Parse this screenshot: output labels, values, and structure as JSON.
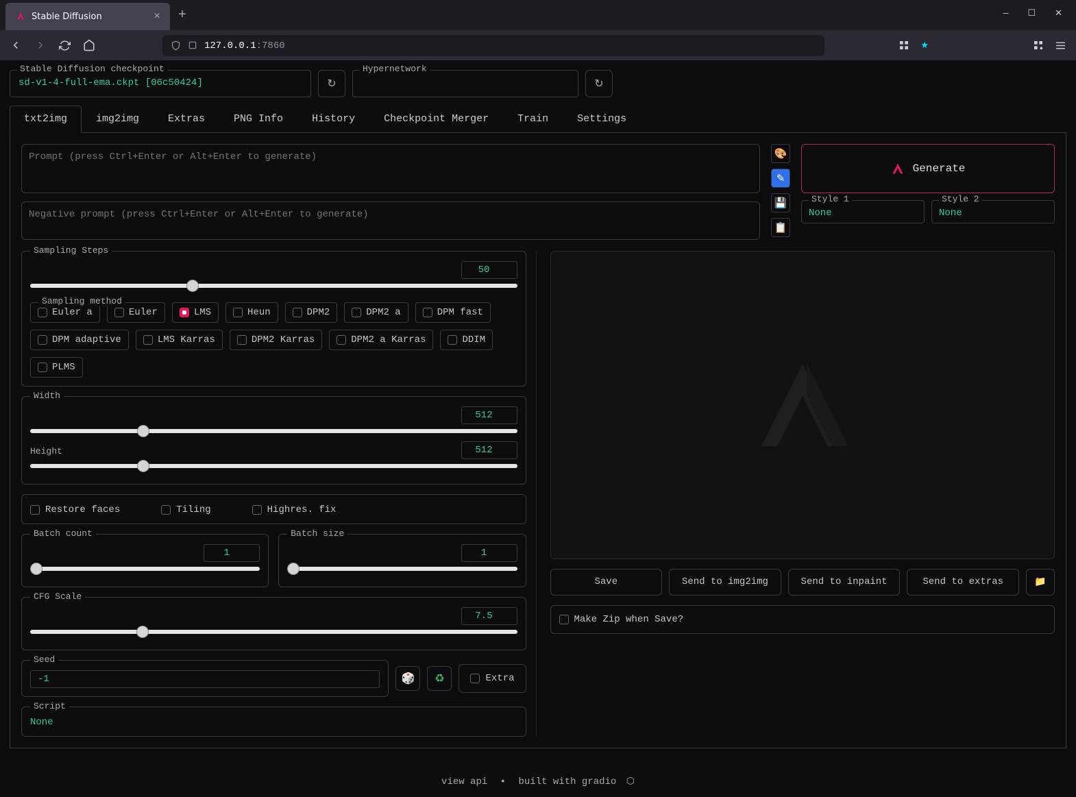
{
  "browser": {
    "tab_title": "Stable Diffusion",
    "url_host": "127.0.0.1",
    "url_port": ":7860"
  },
  "checkpoint": {
    "label": "Stable Diffusion checkpoint",
    "value": "sd-v1-4-full-ema.ckpt [06c50424]"
  },
  "hypernetwork": {
    "label": "Hypernetwork",
    "value": ""
  },
  "tabs": [
    "txt2img",
    "img2img",
    "Extras",
    "PNG Info",
    "History",
    "Checkpoint Merger",
    "Train",
    "Settings"
  ],
  "active_tab": 0,
  "prompt": {
    "placeholder": "Prompt (press Ctrl+Enter or Alt+Enter to generate)",
    "value": ""
  },
  "neg_prompt": {
    "placeholder": "Negative prompt (press Ctrl+Enter or Alt+Enter to generate)",
    "value": ""
  },
  "generate_label": "Generate",
  "style1": {
    "label": "Style 1",
    "value": "None"
  },
  "style2": {
    "label": "Style 2",
    "value": "None"
  },
  "sampling_steps": {
    "label": "Sampling Steps",
    "value": 50,
    "min": 1,
    "max": 150
  },
  "sampling_method": {
    "label": "Sampling method",
    "options": [
      "Euler a",
      "Euler",
      "LMS",
      "Heun",
      "DPM2",
      "DPM2 a",
      "DPM fast",
      "DPM adaptive",
      "LMS Karras",
      "DPM2 Karras",
      "DPM2 a Karras",
      "DDIM",
      "PLMS"
    ],
    "selected": "LMS"
  },
  "width": {
    "label": "Width",
    "value": 512,
    "min": 64,
    "max": 2048
  },
  "height": {
    "label": "Height",
    "value": 512,
    "min": 64,
    "max": 2048
  },
  "restore_faces": {
    "label": "Restore faces",
    "checked": false
  },
  "tiling": {
    "label": "Tiling",
    "checked": false
  },
  "highres_fix": {
    "label": "Highres. fix",
    "checked": false
  },
  "batch_count": {
    "label": "Batch count",
    "value": 1,
    "min": 1,
    "max": 100
  },
  "batch_size": {
    "label": "Batch size",
    "value": 1,
    "min": 1,
    "max": 8
  },
  "cfg_scale": {
    "label": "CFG Scale",
    "value": 7.5,
    "min": 1,
    "max": 30
  },
  "seed": {
    "label": "Seed",
    "value": -1
  },
  "extra": {
    "label": "Extra",
    "checked": false
  },
  "script": {
    "label": "Script",
    "value": "None"
  },
  "output_buttons": {
    "save": "Save",
    "send_img2img": "Send to img2img",
    "send_inpaint": "Send to inpaint",
    "send_extras": "Send to extras"
  },
  "zip_label": "Make Zip when Save?",
  "footer": {
    "view_api": "view api",
    "built_with": "built with gradio"
  }
}
